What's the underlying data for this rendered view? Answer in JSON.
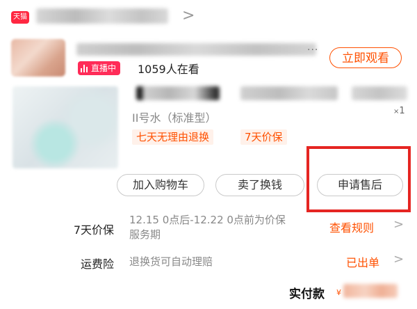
{
  "store": {
    "badge": "天猫",
    "name": "",
    "chevron": ">"
  },
  "live": {
    "title": "",
    "ellipsis": "...",
    "badge_label": "直播中",
    "viewer_count": "1059人在看",
    "watch_button": "立即观看"
  },
  "product": {
    "spec": "II号水（标准型）",
    "quantity_prefix": "×",
    "quantity": "1",
    "tags": [
      "七天无理由退换",
      "7天价保"
    ]
  },
  "actions": {
    "add_to_cart": "加入购物车",
    "sell_for_cash": "卖了换钱",
    "after_sales": "申请售后"
  },
  "rows": {
    "price_protection": {
      "label": "7天价保",
      "text": "12.15 0点后-12.22 0点前为价保服务期",
      "link": "查看规则",
      "chevron": ">"
    },
    "shipping_insurance": {
      "label": "运费险",
      "text": "退换货可自动理赔",
      "link": "已出单",
      "chevron": ">"
    }
  },
  "payment": {
    "label": "实付款",
    "currency": "¥"
  },
  "colors": {
    "accent": "#ff5000",
    "live_badge": "#ff2c58",
    "tmall_red": "#ff2741",
    "highlight": "#e52522"
  }
}
